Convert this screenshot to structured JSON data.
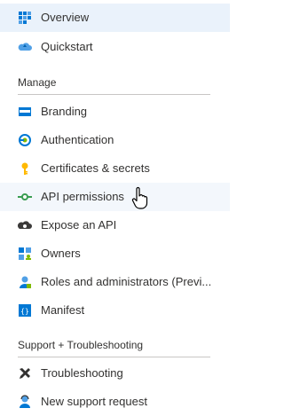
{
  "nav": {
    "top": [
      {
        "label": "Overview",
        "icon": "grid-icon"
      },
      {
        "label": "Quickstart",
        "icon": "cloud-icon"
      }
    ],
    "manage_header": "Manage",
    "manage": [
      {
        "label": "Branding",
        "icon": "branding-icon"
      },
      {
        "label": "Authentication",
        "icon": "authentication-icon"
      },
      {
        "label": "Certificates & secrets",
        "icon": "key-icon"
      },
      {
        "label": "API permissions",
        "icon": "api-permissions-icon"
      },
      {
        "label": "Expose an API",
        "icon": "cloud-gear-icon"
      },
      {
        "label": "Owners",
        "icon": "owners-icon"
      },
      {
        "label": "Roles and administrators (Previ...",
        "icon": "roles-icon"
      },
      {
        "label": "Manifest",
        "icon": "manifest-icon"
      }
    ],
    "support_header": "Support + Troubleshooting",
    "support": [
      {
        "label": "Troubleshooting",
        "icon": "wrench-icon"
      },
      {
        "label": "New support request",
        "icon": "support-person-icon"
      }
    ]
  },
  "colors": {
    "selected_bg": "#eaf2fb",
    "accent": "#0078d4",
    "divider": "#c8c6c4"
  }
}
